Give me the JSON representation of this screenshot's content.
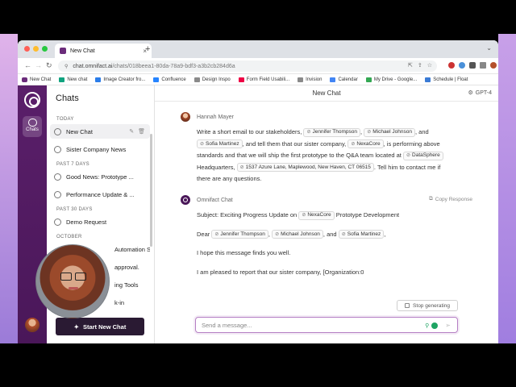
{
  "browser": {
    "tab_title": "New Chat",
    "url_host": "chat.omnifact.ai",
    "url_path": "/chats/018beea1-80da-78a9-bdf3-a3b2cb284d6a",
    "bookmarks": [
      "New Chat",
      "New chat",
      "Image Creator fro...",
      "Confluence",
      "Design Inspo",
      "Form Field Usabili...",
      "Invision",
      "Calendar",
      "My Drive - Google...",
      "Schedule | Float"
    ]
  },
  "rail": {
    "chats_label": "Chats"
  },
  "sidebar": {
    "title": "Chats",
    "sections": [
      {
        "label": "TODAY",
        "items": [
          "New Chat",
          "Sister Company News"
        ]
      },
      {
        "label": "PAST 7 DAYS",
        "items": [
          "Good News: Prototype ...",
          "Performance Update & ..."
        ]
      },
      {
        "label": "PAST 30 DAYS",
        "items": [
          "Demo Request"
        ]
      },
      {
        "label": "OCTOBER",
        "items": [
          "Automation S...",
          "approval.",
          "ing Tools",
          "k-in"
        ]
      }
    ],
    "start_button": "Start New Chat"
  },
  "main": {
    "title": "New Chat",
    "model": "GPT-4",
    "user_message": {
      "author": "Hannah Mayer",
      "t1": "Write a short email to our stakeholders,",
      "c1": "Jennifer Thompson",
      "t2": ",",
      "c2": "Michael Johnson",
      "t3": ", and",
      "c3": "Sofia Martinez",
      "t4": ", and tell them that our sister company,",
      "c4": "NexaCore",
      "t5": ", is performing above standards and that we will ship the first prototype to the Q&A team located at",
      "c5": "DataSphere",
      "t6": "Headquarters,",
      "c6": "1537 Azure Lane, Maplewood, New Haven, CT 06515",
      "t7": ". Tell him to contact me if there are any questions."
    },
    "bot_message": {
      "author": "Omnifact Chat",
      "copy_label": "Copy Response",
      "subject_prefix": "Subject: Exciting Progress Update on",
      "subject_chip": "NexaCore",
      "subject_suffix": "Prototype Development",
      "dear": "Dear",
      "dear_c1": "Jennifer Thompson",
      "dear_sep": ",",
      "dear_c2": "Michael Johnson",
      "dear_and": ", and",
      "dear_c3": "Sofia Martinez",
      "dear_end": ",",
      "line2": "I hope this message finds you well.",
      "line3": "I am pleased to report that our sister company, [Organization:0"
    },
    "stop_label": "Stop generating",
    "input_placeholder": "Send a message..."
  }
}
